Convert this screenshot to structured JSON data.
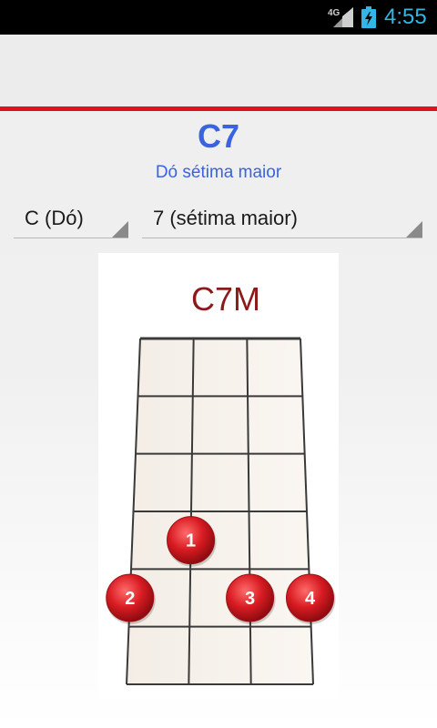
{
  "status_bar": {
    "network": "4G",
    "time": "4:55"
  },
  "chord": {
    "name": "C7",
    "description": "Dó sétima maior"
  },
  "spinners": {
    "root_selected": "C (Dó)",
    "type_selected": "7 (sétima maior)"
  },
  "diagram": {
    "title": "C7M",
    "strings": 4,
    "frets": 6,
    "finger_markers": [
      {
        "label": "1",
        "string": 2,
        "fret": 4
      },
      {
        "label": "2",
        "string": 1,
        "fret": 5
      },
      {
        "label": "3",
        "string": 3,
        "fret": 5
      },
      {
        "label": "4",
        "string": 4,
        "fret": 5
      }
    ],
    "marker_color": "#d81b22",
    "title_color": "#8b1a1a"
  },
  "colors": {
    "accent_line": "#e0101a",
    "chord_text": "#3a63e0",
    "status_time": "#33b5e5"
  }
}
